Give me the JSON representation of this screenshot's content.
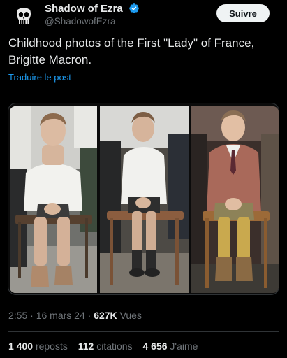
{
  "author": {
    "display_name": "Shadow of Ezra",
    "handle": "@ShadowofEzra",
    "verified": true,
    "avatar_icon": "punisher-skull-icon"
  },
  "follow_button": {
    "label": "Suivre"
  },
  "tweet": {
    "text": "Childhood photos of the First \"Lady\" of France, Brigitte Macron.",
    "translate_label": "Traduire le post"
  },
  "media": {
    "photo_count": 3,
    "photos": [
      {
        "name": "photo-seated-boy-black-and-white-colorized"
      },
      {
        "name": "photo-boy-white-shirt-shorts"
      },
      {
        "name": "photo-boy-cardigan-tie"
      }
    ]
  },
  "meta": {
    "time": "2:55",
    "date": "16 mars 24",
    "views_count": "627K",
    "views_label": "Vues",
    "separator": "·"
  },
  "stats": {
    "reposts_count": "1 400",
    "reposts_label": "reposts",
    "quotes_count": "112",
    "quotes_label": "citations",
    "likes_count": "4 656",
    "likes_label": "J'aime"
  },
  "colors": {
    "background": "#000000",
    "text": "#e7e9ea",
    "secondary": "#71767b",
    "link": "#1d9bf0",
    "verified": "#1d9bf0",
    "border": "#2f3336"
  }
}
